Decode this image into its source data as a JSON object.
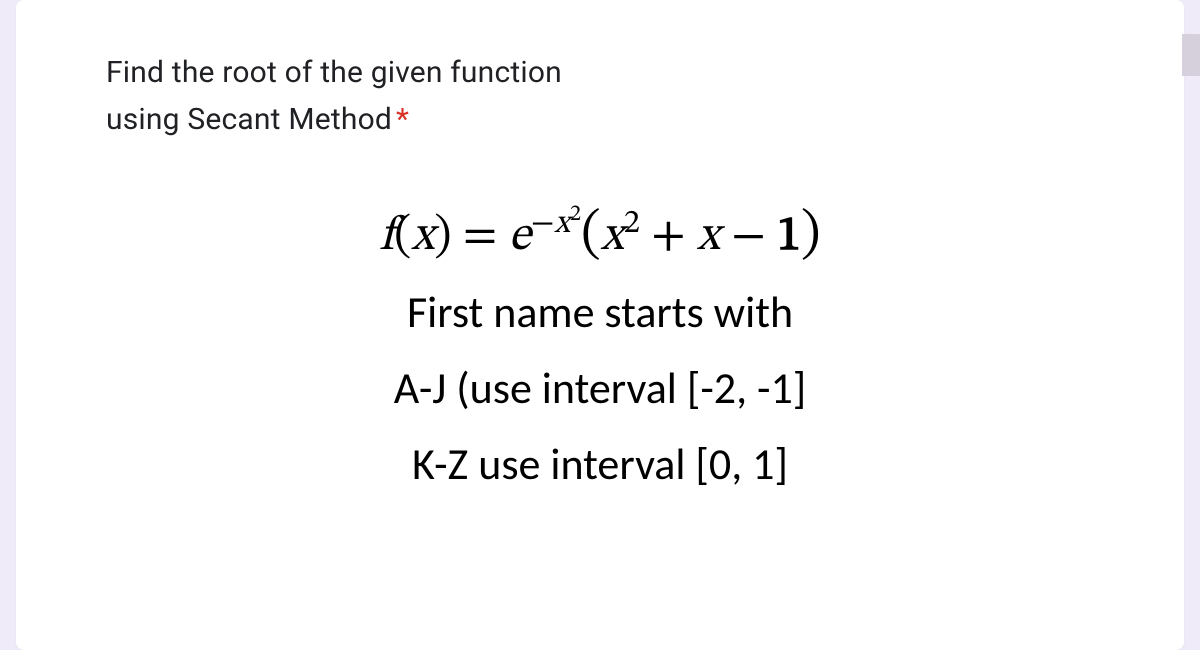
{
  "question": {
    "line1": "Find the root of the given function",
    "line2": "using Secant Method",
    "required_marker": "*"
  },
  "equation": {
    "raw": "f(x) = e^(-x^2)(x^2 + x - 1)",
    "f": "f",
    "open": "(",
    "x": "x",
    "close": ")",
    "equals": " = ",
    "e": "e",
    "exp_neg": "−",
    "exp_x": "x",
    "exp_sq": "2",
    "paren_open": "(",
    "term1_x": "x",
    "term1_sq": "2",
    "plus": " + ",
    "term2_x": "x",
    "minus": " − ",
    "term3": "1",
    "paren_close": ")"
  },
  "instructions": {
    "line1": "First name starts with",
    "line2": "A-J (use interval [-2, -1]",
    "line3": "K-Z use interval [0, 1]"
  }
}
